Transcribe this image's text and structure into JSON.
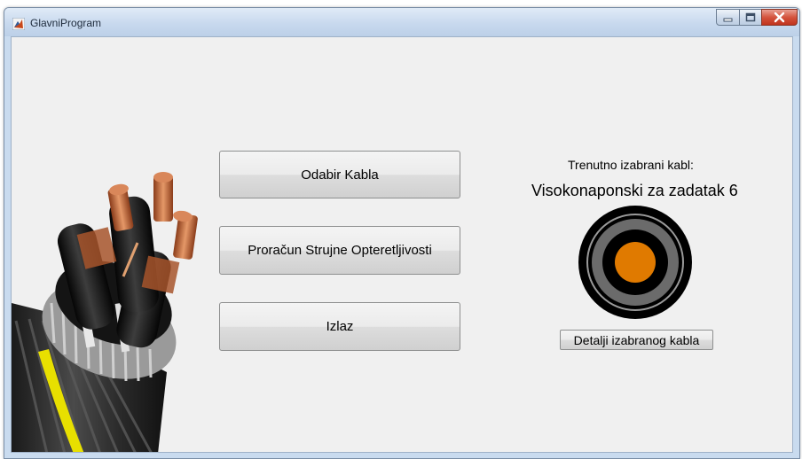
{
  "window": {
    "title": "GlavniProgram"
  },
  "buttons": {
    "select_cable": "Odabir Kabla",
    "current_calc": "Proračun Strujne Opteretljivosti",
    "exit": "Izlaz",
    "cable_details": "Detalji izabranog kabla"
  },
  "selected_cable": {
    "caption": "Trenutno izabrani kabl:",
    "name": "Visokonaponski za zadatak 6"
  },
  "icons": {
    "app": "matlab-icon",
    "minimize": "minimize-icon",
    "maximize": "maximize-icon",
    "close": "close-icon",
    "cable_photo": "power-cable-illustration",
    "cross_section": "cable-cross-section-icon"
  },
  "colors": {
    "conductor": "#e07a00",
    "insulation": "#000000",
    "screen": "#6b6b6b",
    "sheath_ring": "#9a9a9a"
  }
}
